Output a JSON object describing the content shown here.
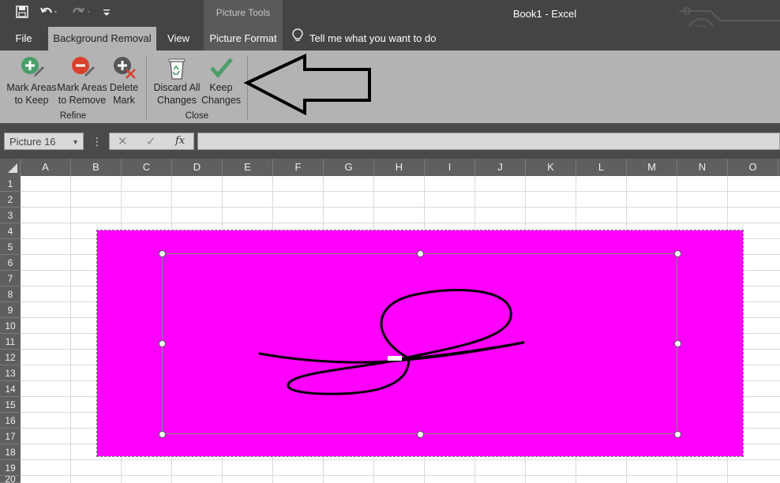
{
  "titlebar": {
    "window_title": "Book1  -  Excel",
    "contextual_group": "Picture Tools"
  },
  "tabs": [
    {
      "label": "File"
    },
    {
      "label": "Background Removal"
    },
    {
      "label": "View"
    },
    {
      "label": "Picture Format"
    }
  ],
  "tell_me": {
    "placeholder": "Tell me what you want to do"
  },
  "ribbon": {
    "refine": {
      "label": "Refine",
      "mark_keep": [
        "Mark Areas",
        "to Keep"
      ],
      "mark_remove": [
        "Mark Areas",
        "to Remove"
      ],
      "delete_mark": [
        "Delete",
        "Mark"
      ]
    },
    "close": {
      "label": "Close",
      "discard": [
        "Discard All",
        "Changes"
      ],
      "keep": [
        "Keep",
        "Changes"
      ]
    }
  },
  "formula_bar": {
    "name_box": "Picture 16",
    "fx": "fx",
    "value": ""
  },
  "columns": [
    "A",
    "B",
    "C",
    "D",
    "E",
    "F",
    "G",
    "H",
    "I",
    "J",
    "K",
    "L",
    "M",
    "N",
    "O"
  ],
  "rows": [
    "1",
    "2",
    "3",
    "4",
    "5",
    "6",
    "7",
    "8",
    "9",
    "10",
    "11",
    "12",
    "13",
    "14",
    "15",
    "16",
    "17",
    "18",
    "19",
    "20"
  ],
  "colors": {
    "picture_background": "#ff00ff",
    "keep_green": "#4a9e6a",
    "remove_red": "#d9412c"
  }
}
